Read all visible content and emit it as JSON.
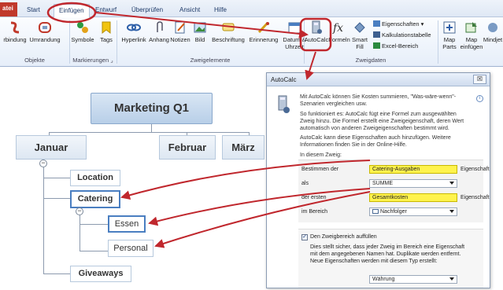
{
  "tabs": [
    "atei",
    "Start",
    "Einfügen",
    "Entwurf",
    "Überprüfen",
    "Ansicht",
    "Hilfe"
  ],
  "ribbon": {
    "buttons": [
      {
        "label": "rbindung"
      },
      {
        "label": "Umrandung"
      },
      {
        "label": "Symbole"
      },
      {
        "label": "Tags"
      },
      {
        "label": "Hyperlink"
      },
      {
        "label": "Anhang"
      },
      {
        "label": "Notizen"
      },
      {
        "label": "Bild"
      },
      {
        "label": "Beschriftung"
      },
      {
        "label": "Erinnerung"
      },
      {
        "label": "Datum &",
        "label2": "Uhrzeit"
      },
      {
        "label": "AutoCalc"
      },
      {
        "label": "Formeln"
      },
      {
        "label": "Smart",
        "label2": "Fill"
      },
      {
        "label": "Map",
        "label2": "Parts"
      },
      {
        "label": "Map",
        "label2": "einfügen"
      },
      {
        "label": "Mindjet"
      }
    ],
    "small": [
      "Eigenschaften",
      "Kalkulationstabelle",
      "Excel-Bereich"
    ],
    "groups": [
      "Objekte",
      "Markierungen",
      "Zweigelemente",
      "Zweigdaten"
    ]
  },
  "map": {
    "central": "Marketing Q1",
    "main": [
      "Januar",
      "Februar",
      "März"
    ],
    "subs": [
      "Location",
      "Catering",
      "Giveaways"
    ],
    "subsubs": [
      "Essen",
      "Personal"
    ]
  },
  "dialog": {
    "title": "AutoCalc",
    "close": "☒",
    "intro": "Mit AutoCalc können Sie Kosten summieren, \"Was-wäre-wenn\"-Szenarien vergleichen usw.",
    "p2": "So funktioniert es: AutoCalc fügt eine Formel zum ausgewählten Zweig hinzu. Die Formel erstellt eine Zweigeigenschaft, deren Wert automatisch von anderen Zweigeigenschaften bestimmt wird.",
    "p3": "AutoCalc kann diese Eigenschaften auch hinzufügen. Weitere Informationen finden Sie in der Online-Hilfe.",
    "section": "In diesem Zweig:",
    "row1_label": "Bestimmen der",
    "row1_value": "Catering-Ausgaben",
    "row1_suffix": "Eigenschaft",
    "row2_label": "als",
    "row2_value": "SUMME",
    "row3_label": "der ersten",
    "row3_value": "Gesamtkosten",
    "row3_suffix": "Eigenschaft",
    "row4_label": "im Bereich",
    "row4_value": "Nachfolger",
    "checkbox_label": "Den Zweigbereich auffüllen",
    "checkbox_desc": "Dies stellt sicher, dass jeder Zweig im Bereich eine Eigenschaft mit dem angegebenen Namen hat. Duplikate werden entfernt. Neue Eigenschaften werden mit diesem Typ erstellt:",
    "type_value": "Währung"
  },
  "colors": {
    "highlight": "#fff34d",
    "arrow": "#c0272d",
    "accent": "#4a7ec1"
  }
}
